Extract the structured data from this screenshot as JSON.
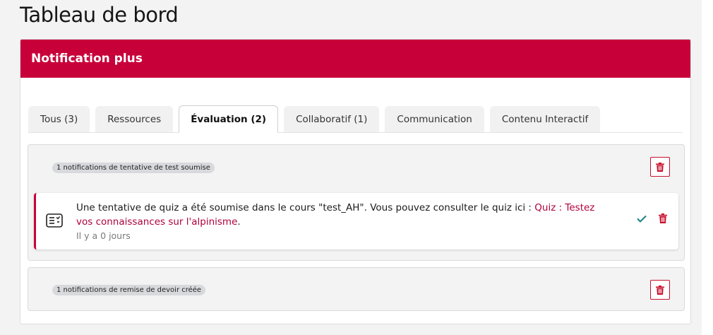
{
  "page": {
    "title": "Tableau de bord"
  },
  "card": {
    "title": "Notification plus"
  },
  "tabs": [
    {
      "label": "Tous (3)"
    },
    {
      "label": "Ressources"
    },
    {
      "label": "Évaluation (2)",
      "active": true
    },
    {
      "label": "Collaboratif (1)"
    },
    {
      "label": "Communication"
    },
    {
      "label": "Contenu Interactif"
    }
  ],
  "groups": [
    {
      "badge": "1 notifications de tentative de test soumise",
      "delete_icon": "trash-icon",
      "notification": {
        "icon": "list-document-icon",
        "text_before": "Une tentative de quiz a été soumise dans le cours \"test_AH\". Vous pouvez consulter le quiz ici : ",
        "link_text": "Quiz : Testez vos connaissances sur l'alpinisme",
        "text_after": ".",
        "time": "Il y a 0 jours",
        "mark_read_icon": "check-icon",
        "delete_icon": "trash-icon"
      }
    },
    {
      "badge": "1 notifications de remise de devoir créée",
      "delete_icon": "trash-icon"
    }
  ],
  "colors": {
    "brand": "#c8003a",
    "link": "#b0003a",
    "check": "#1a8080",
    "trash": "#c8102e"
  }
}
